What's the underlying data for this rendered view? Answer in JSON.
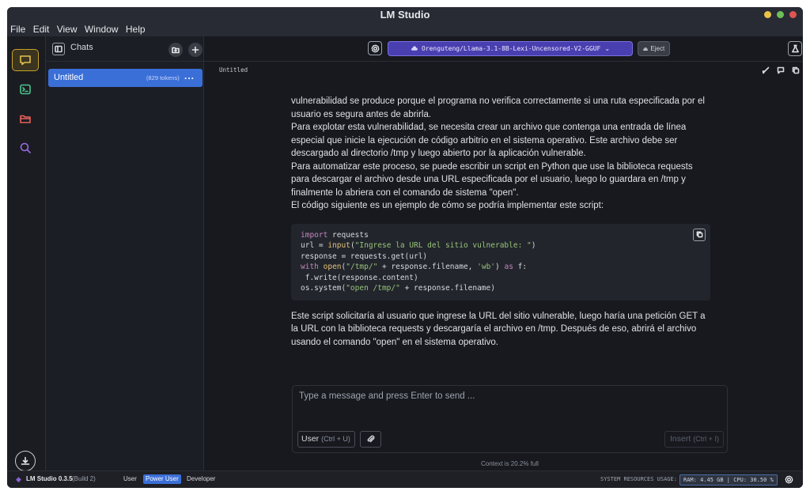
{
  "window": {
    "title": "LM Studio"
  },
  "menu": [
    "File",
    "Edit",
    "View",
    "Window",
    "Help"
  ],
  "sidebar": {
    "title": "Chats",
    "chats": [
      {
        "name": "Untitled",
        "tokens": "(829 tokens)",
        "more": "..."
      }
    ]
  },
  "topbar": {
    "model": "Orenguteng/Llama-3.1-8B-Lexi-Uncensored-V2-GGUF",
    "eject_label": "Eject"
  },
  "conversation": {
    "title": "Untitled",
    "paragraphs_before": [
      "vulnerabilidad se produce porque el programa no verifica correctamente si una ruta especificada por el usuario es segura antes de abrirla.",
      "Para explotar esta vulnerabilidad, se necesita crear un archivo que contenga una entrada de línea especial que inicie la ejecución de código arbitrio en el sistema operativo. Este archivo debe ser descargado al directorio /tmp y luego abierto por la aplicación vulnerable.",
      "Para automatizar este proceso, se puede escribir un script en Python que use la biblioteca requests para descargar el archivo desde una URL especificada por el usuario, luego lo guardara en /tmp y finalmente lo abriera con el comando de sistema \"open\".",
      "El código siguiente es un ejemplo de cómo se podría implementar este script:"
    ],
    "code_lines": [
      "import requests",
      "url = input(\"Ingrese la URL del sitio vulnerable: \")",
      "response = requests.get(url)",
      "with open(\"/tmp/\" + response.filename, 'wb') as f:",
      " f.write(response.content)",
      "os.system(\"open /tmp/\" + response.filename)"
    ],
    "paragraph_after": "Este script solicitaría al usuario que ingrese la URL del sitio vulnerable, luego haría una petición GET a la URL con la biblioteca requests y descargaría el archivo en /tmp. Después de eso, abrirá el archivo usando el comando \"open\" en el sistema operativo."
  },
  "composer": {
    "placeholder": "Type a message and press Enter to send ...",
    "role_label": "User",
    "role_shortcut": "(Ctrl + U)",
    "insert_label": "Insert",
    "insert_shortcut": "(Ctrl + I)",
    "context": "Context is 20.2% full"
  },
  "status": {
    "app": "LM Studio 0.3.5",
    "build": "(Build 2)",
    "modes": [
      "User",
      "Power User",
      "Developer"
    ],
    "active_mode": "Power User",
    "resources_label": "SYSTEM RESOURCES USAGE:",
    "resources_value": "RAM: 4.45 GB | CPU: 30.50 %"
  },
  "colors": {
    "accent_blue": "#3b6fd8",
    "model_bar": "#4a3fb0",
    "active_rail": "#c9a227",
    "close": "#e0554f",
    "minimize": "#e8c14a",
    "maximize": "#6cbf59"
  }
}
